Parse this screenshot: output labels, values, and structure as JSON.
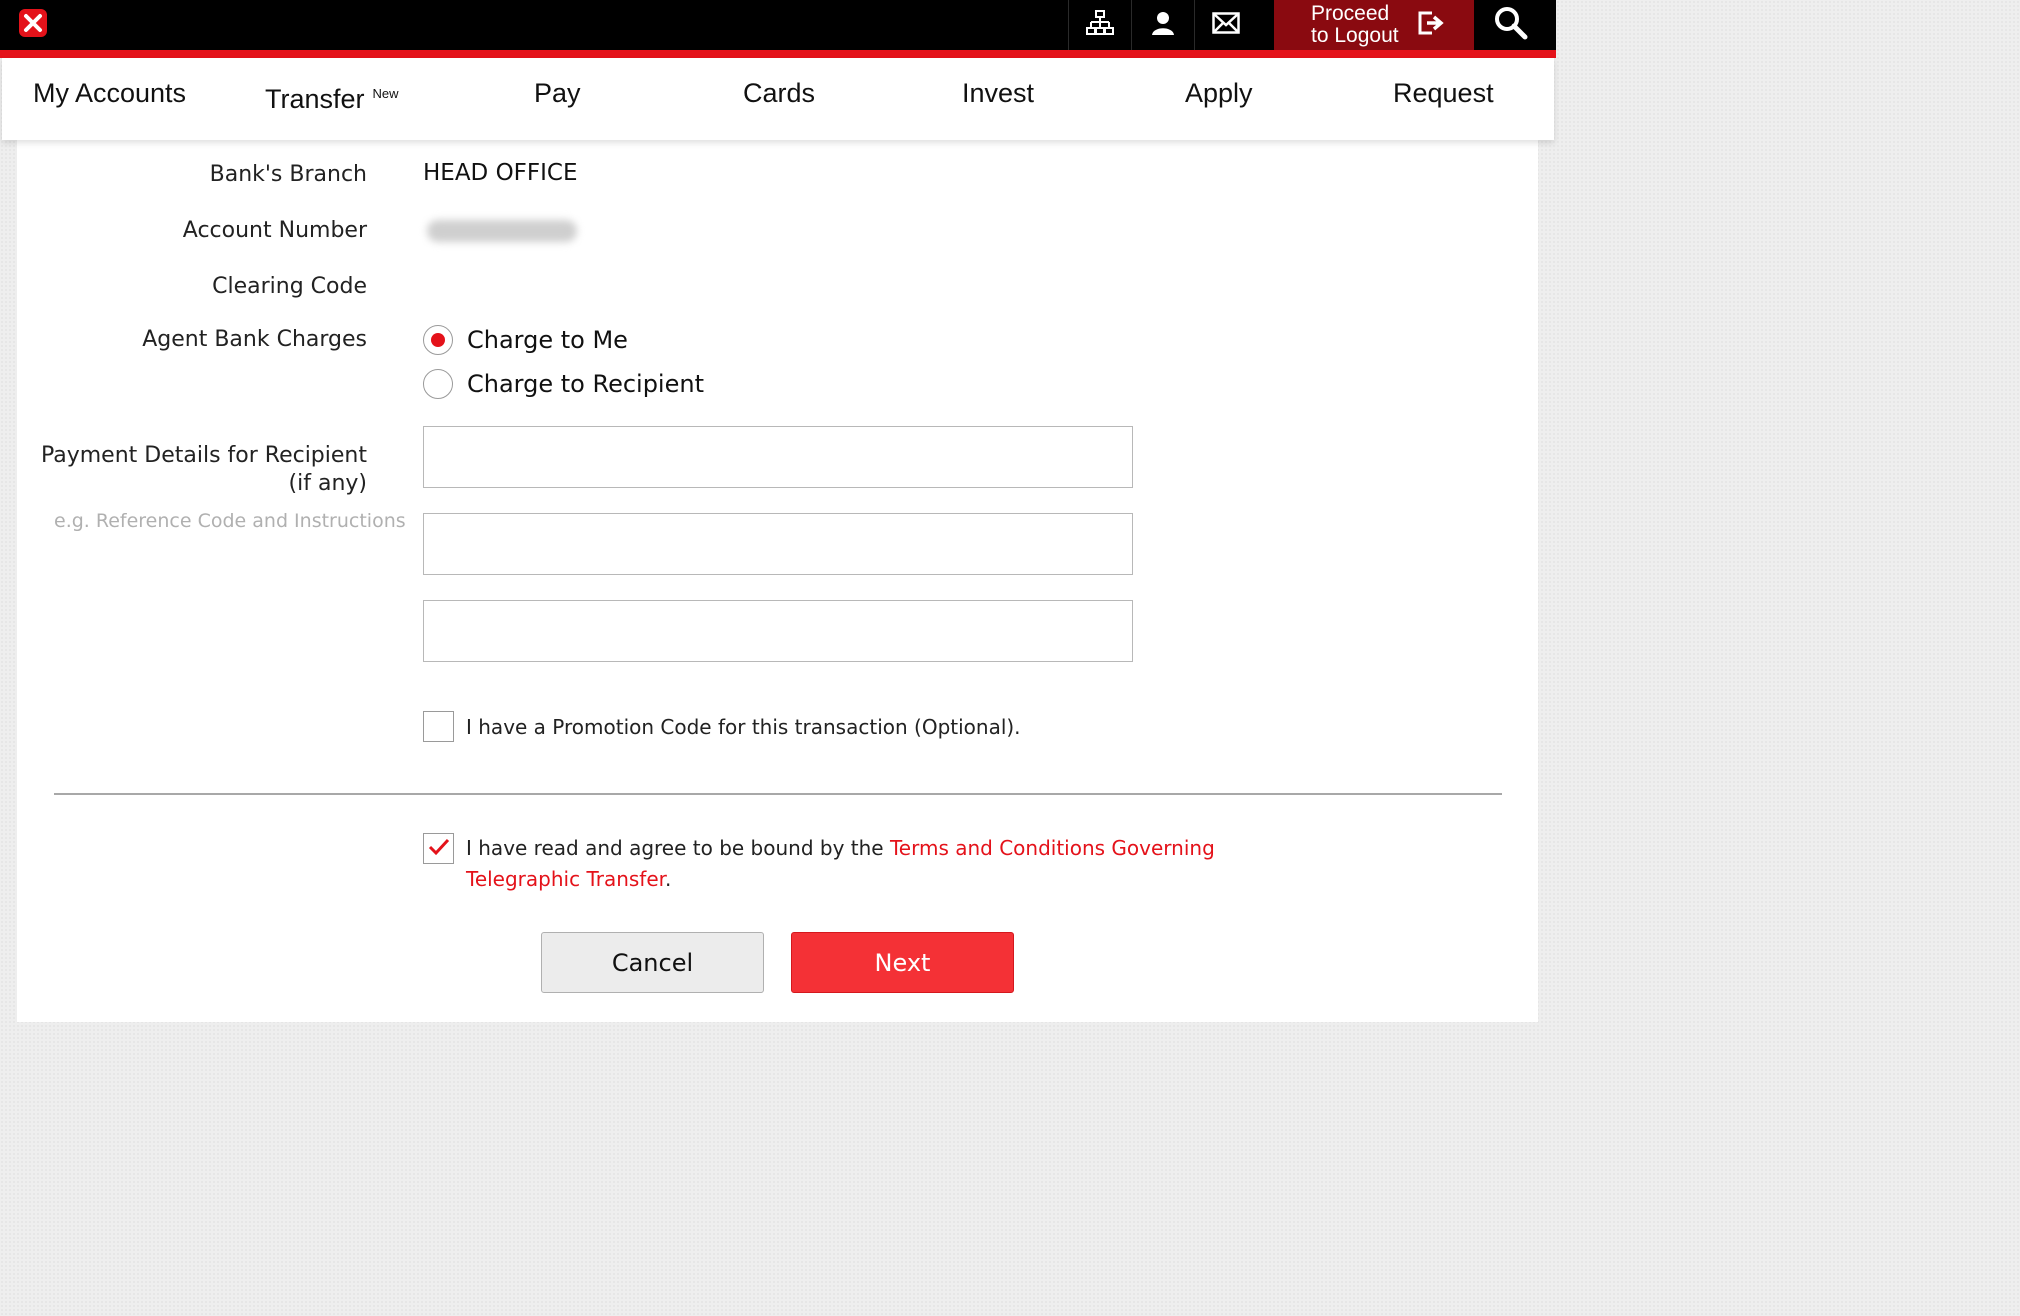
{
  "topbar": {
    "logo_icon": "bank-logo-icon",
    "icons": [
      "sitemap-icon",
      "user-icon",
      "mail-icon"
    ],
    "logout_label": "Proceed to Logout",
    "logout_icon": "logout-icon",
    "search_icon": "search-icon",
    "accent_color": "#e4121a"
  },
  "nav": {
    "items": [
      {
        "label": "My Accounts"
      },
      {
        "label": "Transfer",
        "badge": "New"
      },
      {
        "label": "Pay"
      },
      {
        "label": "Cards"
      },
      {
        "label": "Invest"
      },
      {
        "label": "Apply"
      },
      {
        "label": "Request"
      }
    ]
  },
  "form": {
    "branch_label": "Bank's Branch",
    "branch_value": "HEAD OFFICE",
    "account_label": "Account Number",
    "clearing_label": "Clearing Code",
    "charges_label": "Agent Bank Charges",
    "charge_options": [
      {
        "label": "Charge to Me",
        "selected": true
      },
      {
        "label": "Charge to Recipient",
        "selected": false
      }
    ],
    "payment_details_label": "Payment Details for Recipient",
    "payment_details_sub": "(if any)",
    "payment_details_hint": "e.g. Reference Code and Instructions",
    "payment_lines": [
      "",
      "",
      ""
    ],
    "promo_label": "I have a Promotion Code for this transaction (Optional).",
    "promo_checked": false,
    "terms_prefix": "I have read and agree to be bound by the ",
    "terms_link_line1": "Terms and Conditions Governing",
    "terms_link_line2": "Telegraphic Transfer",
    "terms_suffix": ".",
    "terms_checked": true
  },
  "buttons": {
    "cancel": "Cancel",
    "next": "Next"
  }
}
